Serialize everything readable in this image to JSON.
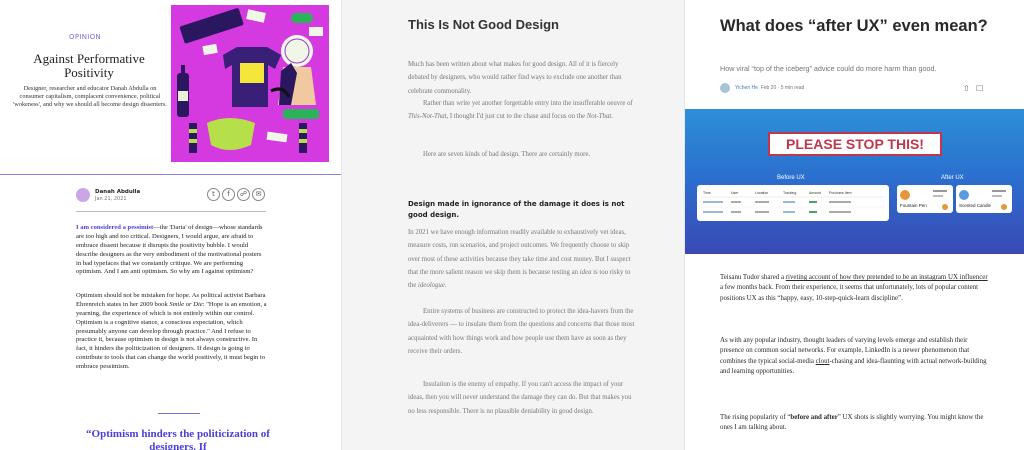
{
  "panel1": {
    "category": "OPINION",
    "title": "Against Performative Positivity",
    "subtitle": "Designer, researcher and educator Danah Abdulla on consumer capitalism, complacent convenience, political 'wokeness', and why we should all become design dissenters.",
    "author": "Danah Abdulla",
    "date": "Jan 21, 2021",
    "p1_lead": "I am considered a pessimist",
    "p1_rest": "—the 'Daria' of design—whose standards are too high and too critical. Designers, I would argue, are afraid to embrace dissent because it disrupts the positivity bubble. I would describe designers as the very embodiment of the motivational posters in bad typefaces that we constantly critique. We are performing optimism. And I am anti optimism. So why am I against optimism?",
    "p2_a": "Optimism should not be mistaken for hope. As political activist Barbara Ehrenreich states in her 2009 book ",
    "p2_book": "Smile or Die",
    "p2_b": ": \"Hope is an emotion, a yearning, the experience of which is not entirely within our control. Optimism is a cognitive stance, a conscious expectation, which presumably anyone can develop through practice.\" And I refuse to practice it, because optimism in design is not always constructive. In fact, it hinders the politicization of designers. If design is going to contribute to tools that can change the world positively, it must begin to embrace pessimism.",
    "quote": "“Optimism hinders the politicization of designers. If"
  },
  "panel2": {
    "title": "This Is Not Good Design",
    "para1": "Much has been written about what makes for good design. All of it is fiercely debated by designers, who would rather find ways to exclude one another than celebrate commonality.",
    "para2_a": "Rather than write yet another forgettable entry into the insufferable oeuvre of ",
    "para2_i1": "This-Not-That",
    "para2_b": ", I thought I'd just cut to the chase and focus on the ",
    "para2_i2": "Not-That",
    "para2_c": ".",
    "para3": "Here are seven kinds of bad design. There are certainly more.",
    "heading": "Design made in ignorance of the damage it does is not good design.",
    "para4_a": "In 2021 we have enough information readily available to exhaustively vet ideas, measure costs, run scenarios, and project outcomes. We frequently choose to skip over most of these activities because they take time and cost money. But I suspect that the more salient reason we skip them is because testing an ",
    "para4_i1": "idea",
    "para4_b": " is too risky to the ",
    "para4_i2": "ideologue",
    "para4_c": ".",
    "para5": "Entire systems of business are constructed to protect the idea-havers from the idea-deliverers — to insulate them from the questions and concerns that those most acquainted with how things work and how people use them have as soon as they receive their orders.",
    "para6": "Insulation is the enemy of empathy. If you can't access the impact of your ideas, then you will never understand the damage they can do. But that makes you no less responsible. There is no plausible deniability in good design."
  },
  "panel3": {
    "title": "What does “after UX” even mean?",
    "subtitle": "How viral “top of the iceberg” advice could do more harm than good.",
    "author": "Yichen He",
    "date": "Feb 20",
    "read_time": "5 min read",
    "hero_banner": "PLEASE STOP THIS!",
    "before_label": "Before UX",
    "after_label": "After UX",
    "table_headers": [
      "Time",
      "User",
      "Location",
      "Tracking",
      "Amount",
      "Purchase Item"
    ],
    "card1_label": "Fountain Pen",
    "card2_label": "Scented Candle",
    "para1_a": "Teisanu Tudor shared a ",
    "para1_link": "riveting account of how they pretended to be an instagram UX influencer",
    "para1_b": " a few months back. From their experience, it seems that unfortunately, lots of popular content positions UX as this “happy, easy, 10-step-quick-learn discipline”.",
    "para2_a": "As with any popular industry, thought leaders of varying levels emerge and establish their presence on common social networks. For example, LinkedIn is a newer phenomenon that combines the typical social-media ",
    "para2_link": "clout",
    "para2_b": "-chasing and idea-flaunting with actual network-building and learning opportunities.",
    "para3_a": "The rising popularity of “",
    "para3_b": "before and after",
    "para3_c": "” UX shots is slightly worrying. You might know the ones I am talking about."
  },
  "colors": {
    "accent_purple": "#4a3ed6",
    "art_magenta": "#d43ae0",
    "hero_blue": "#2b71cf",
    "stop_red": "#c2364a"
  }
}
